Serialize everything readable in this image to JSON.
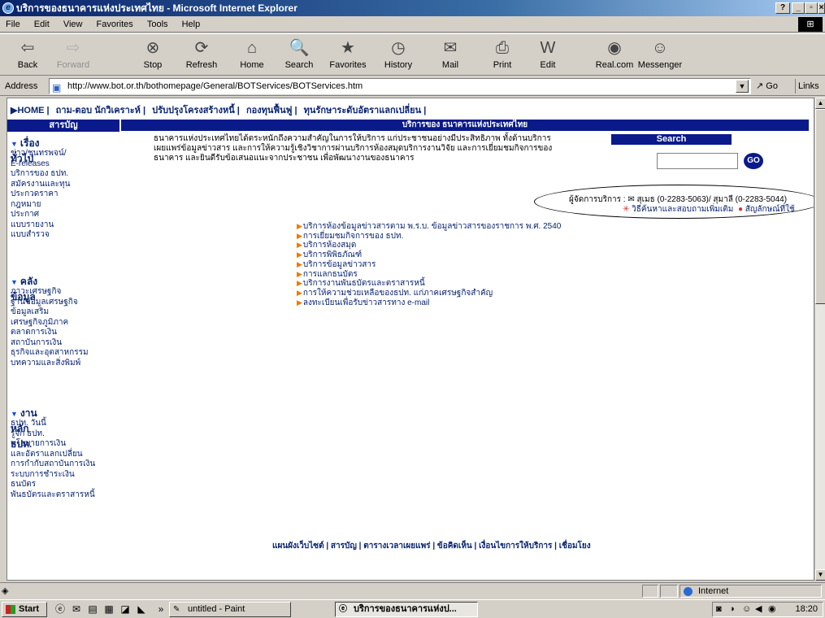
{
  "window": {
    "title": "บริการของธนาคารแห่งประเทศไทย - Microsoft Internet Explorer"
  },
  "menu": [
    "File",
    "Edit",
    "View",
    "Favorites",
    "Tools",
    "Help"
  ],
  "toolbar": [
    {
      "label": "Back",
      "icon": "back-arrow-icon",
      "glyph": "⇦",
      "enabled": true
    },
    {
      "label": "Forward",
      "icon": "forward-arrow-icon",
      "glyph": "⇨",
      "enabled": false
    },
    {
      "label": "Stop",
      "icon": "stop-icon",
      "glyph": "⊗",
      "enabled": true
    },
    {
      "label": "Refresh",
      "icon": "refresh-icon",
      "glyph": "⟳",
      "enabled": true
    },
    {
      "label": "Home",
      "icon": "home-icon",
      "glyph": "⌂",
      "enabled": true
    },
    {
      "label": "Search",
      "icon": "search-icon",
      "glyph": "🔍",
      "enabled": true
    },
    {
      "label": "Favorites",
      "icon": "favorites-icon",
      "glyph": "★",
      "enabled": true
    },
    {
      "label": "History",
      "icon": "history-icon",
      "glyph": "◷",
      "enabled": true
    },
    {
      "label": "Mail",
      "icon": "mail-icon",
      "glyph": "✉",
      "enabled": true
    },
    {
      "label": "Print",
      "icon": "print-icon",
      "glyph": "⎙",
      "enabled": true
    },
    {
      "label": "Edit",
      "icon": "edit-icon",
      "glyph": "W",
      "enabled": true
    },
    {
      "label": "Real.com",
      "icon": "realcom-icon",
      "glyph": "◉",
      "enabled": true
    },
    {
      "label": "Messenger",
      "icon": "messenger-icon",
      "glyph": "☺",
      "enabled": true
    }
  ],
  "address": {
    "label": "Address",
    "url": "http://www.bot.or.th/bothomepage/General/BOTServices/BOTServices.htm",
    "go": "Go",
    "links": "Links »"
  },
  "topnav": [
    "▶HOME |",
    "ถาม-ตอบ นักวิเคราะห์ |",
    "ปรับปรุงโครงสร้างหนี้ |",
    "กองทุนฟื้นฟู |",
    "ทุนรักษาระดับอัตราแลกเปลี่ยน |"
  ],
  "sidebar": {
    "header": "สารบัญ",
    "sections": [
      {
        "title": "เรื่องทั่วไป",
        "links": [
          "ข่าว/ชุนทรพจน์/",
          "E-releases",
          "บริการของ ธปท.",
          "สมัครงานและทุน",
          "ประกวดราคา",
          "กฎหมาย",
          "ประกาศ",
          "แบบรายงาน",
          "แบบสำรวจ"
        ]
      },
      {
        "title": "คลังข้อมูล",
        "links": [
          "ภาวะเศรษฐกิจ",
          "ฐานข้อมูลเศรษฐกิจ",
          "ข้อมูลเสริม",
          "เศรษฐกิจภูมิภาค",
          "ตลาดการเงิน",
          "สถาบันการเงิน",
          "ธุรกิจและอุตสาหกรรม",
          "บทความและสิ่งพิมพ์"
        ]
      },
      {
        "title": "งานหลัก ธปท.",
        "links": [
          "ธปท. วันนี้",
          "รู้จัก ธปท.",
          "นโยบายการเงิน",
          "และอัตราแลกเปลี่ยน",
          "การกำกับสถาบันการเงิน",
          "ระบบการชำระเงิน",
          "ธนบัตร",
          "พันธบัตรและตราสารหนี้"
        ]
      }
    ]
  },
  "main": {
    "header": "บริการของ ธนาคารแห่งประเทศไทย",
    "intro": [
      "ธนาคารแห่งประเทศไทยได้ตระหนักถึงความสำคัญในการให้บริการ แก่ประชาชนอย่างมีประสิทธิภาพ ทั้งด้านบริการ",
      "เผยแพร่ข้อมูลข่าวสาร และการให้ความรู้เชิงวิชาการผ่านบริการห้องสมุดบริการงานวิจัย และการเยี่ยมชมกิจการของ",
      "ธนาคาร และยินดีรับข้อเสนอแนะจากประชาชน เพื่อพัฒนางานของธนาคาร"
    ],
    "search": {
      "title": "Search",
      "go": "GO"
    },
    "contact": {
      "line1": "ผู้จัดการบริการ : ✉ สุเมธ (0-2283-5063)/ สุมาลี (0-2283-5044)",
      "more": "วิธีค้นหาและสอบถามเพิ่มเติม",
      "symbol": "สัญลักษณ์ที่ใช้"
    },
    "services": [
      "บริการห้องข้อมูลข่าวสารตาม พ.ร.บ. ข้อมูลข่าวสารของราชการ พ.ศ. 2540",
      "การเยี่ยมชมกิจการของ ธปท.",
      "บริการห้องสมุด",
      "บริการพิพิธภัณฑ์",
      "บริการข้อมูลข่าวสาร",
      "การแลกธนบัตร",
      "บริการงานพันธบัตรและตราสารหนี้",
      "การให้ความช่วยเหลือของธปท. แก่ภาคเศรษฐกิจสำคัญ",
      "ลงทะเบียนเพื่อรับข่าวสารทาง e-mail"
    ],
    "footer": "แผนผังเว็บไซต์ | สารบัญ | ตารางเวลาเผยแพร่ | ข้อคิดเห็น | เงื่อนไขการให้บริการ | เชื่อมโยง"
  },
  "status": {
    "zone": "Internet"
  },
  "taskbar": {
    "start": "Start",
    "tasks": [
      {
        "label": "untitled - Paint",
        "active": false
      },
      {
        "label": "บริการของธนาคารแห่งป...",
        "active": true
      }
    ],
    "time": "18:20"
  }
}
